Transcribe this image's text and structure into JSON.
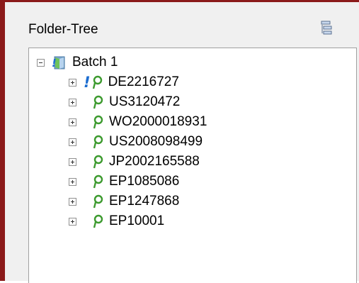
{
  "panel": {
    "title": "Folder-Tree",
    "header_icon": "collapse-all-icon"
  },
  "tree": {
    "root": {
      "label": "Batch 1",
      "icon": "batch-folder-icon",
      "expanded": true
    },
    "items": [
      {
        "label": "DE2216727",
        "icon": "patent-icon",
        "warning": true
      },
      {
        "label": "US3120472",
        "icon": "patent-icon",
        "warning": false
      },
      {
        "label": "WO2000018931",
        "icon": "patent-icon",
        "warning": false
      },
      {
        "label": "US2008098499",
        "icon": "patent-icon",
        "warning": false
      },
      {
        "label": "JP2002165588",
        "icon": "patent-icon",
        "warning": false
      },
      {
        "label": "EP1085086",
        "icon": "patent-icon",
        "warning": false
      },
      {
        "label": "EP1247868",
        "icon": "patent-icon",
        "warning": false
      },
      {
        "label": "EP10001",
        "icon": "patent-icon",
        "warning": false
      }
    ]
  },
  "colors": {
    "frame": "#8b1a1a",
    "panel_bg": "#f0f0f0",
    "leaf_green": "#3c9a2e",
    "warning_blue": "#1c6dd0"
  }
}
